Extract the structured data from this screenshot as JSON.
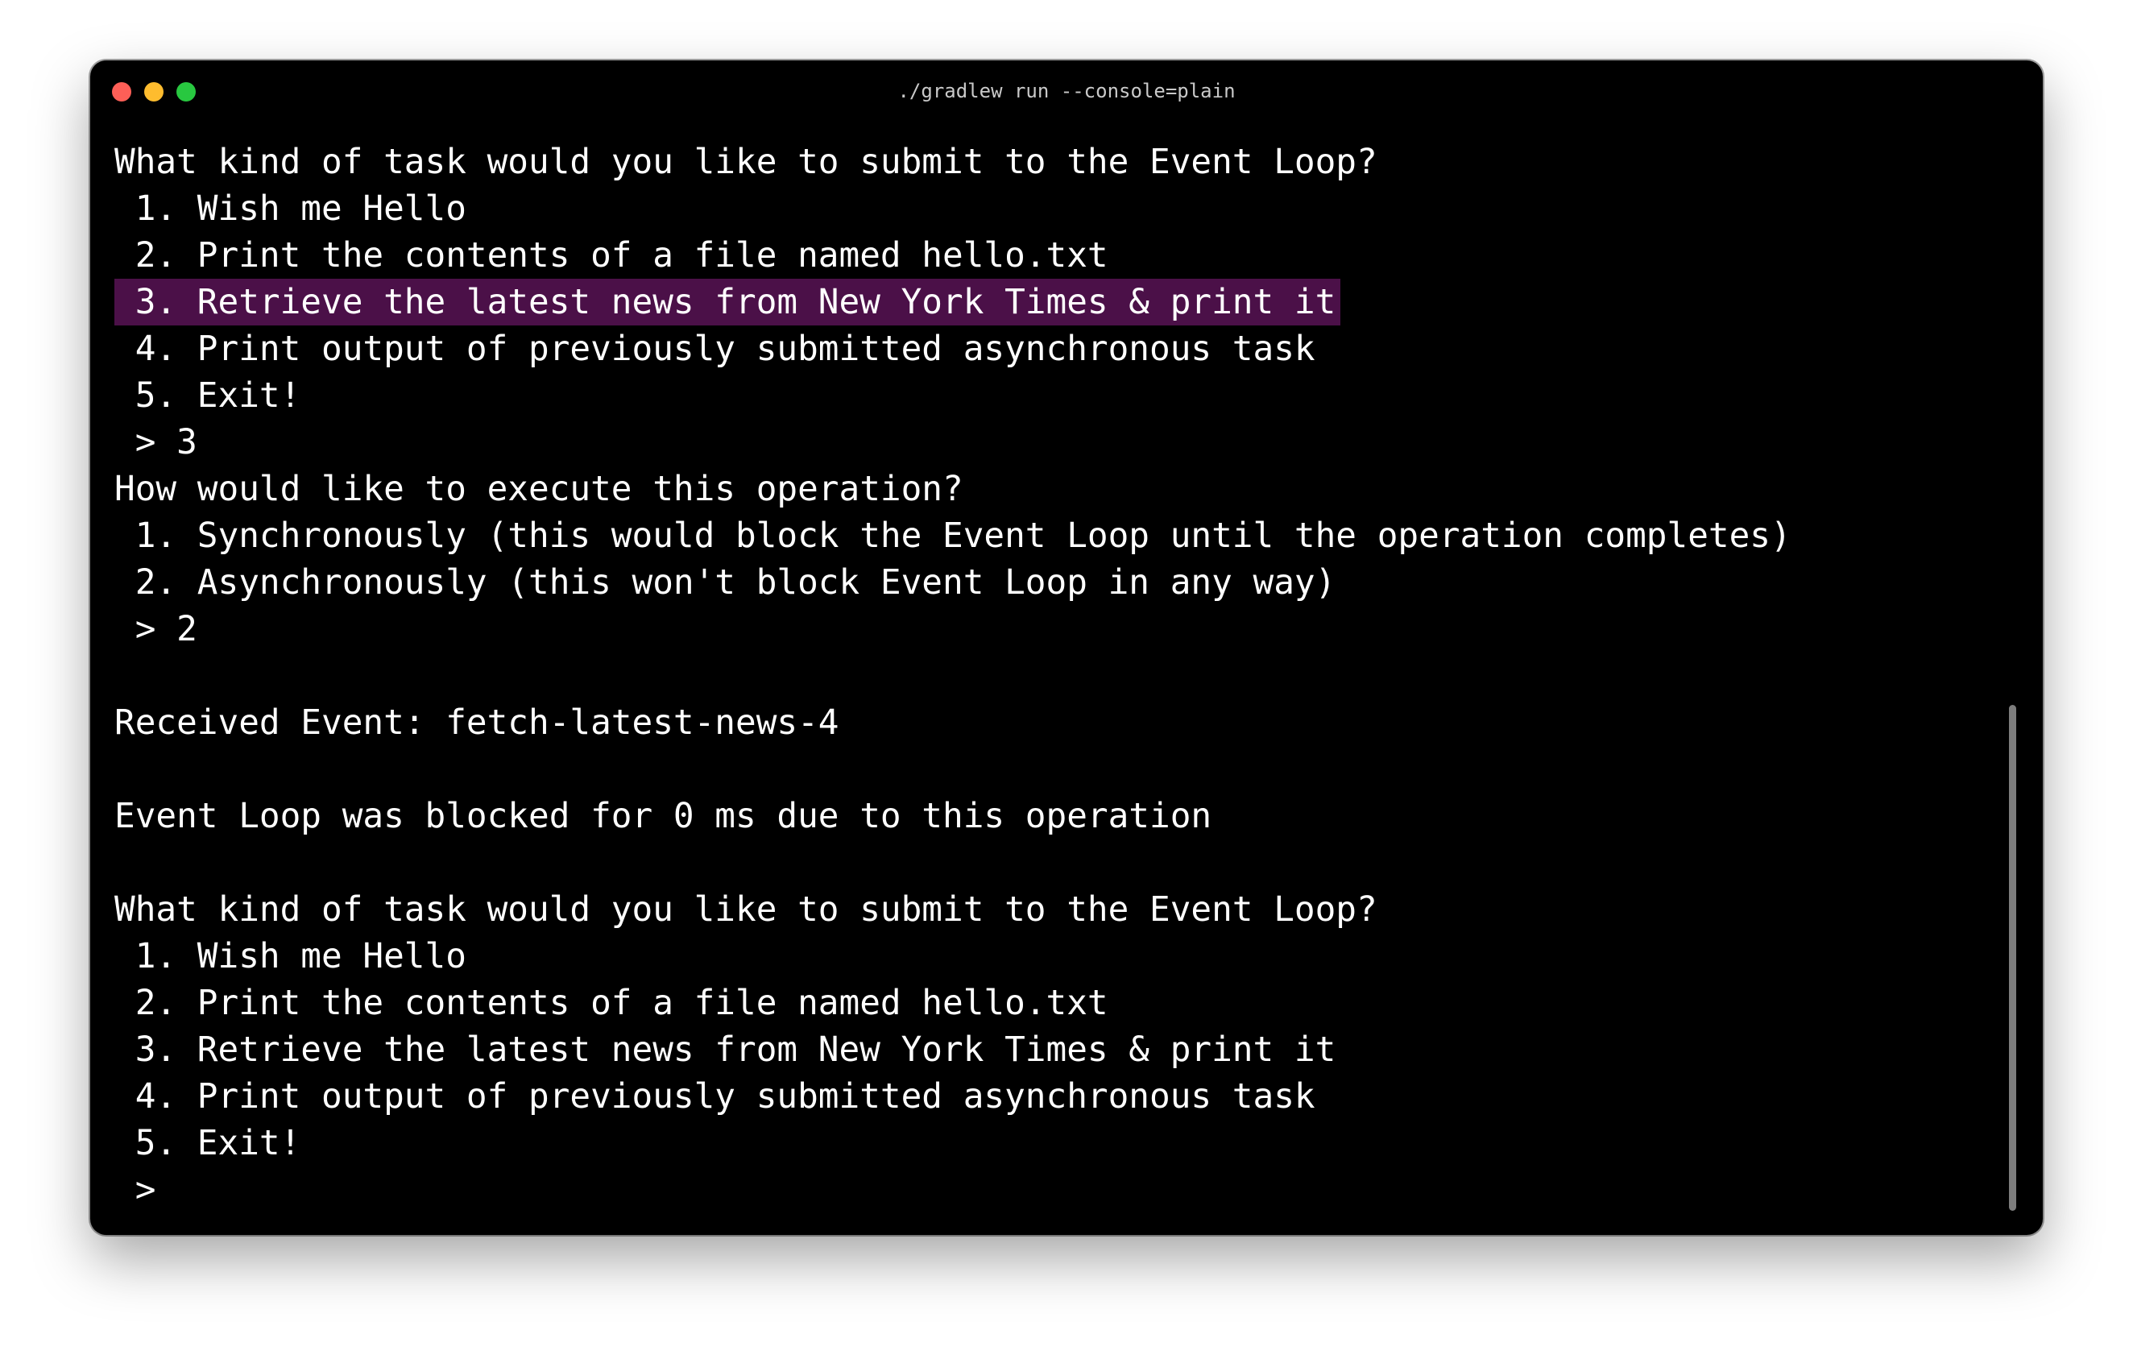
{
  "window": {
    "title": "./gradlew run --console=plain"
  },
  "terminal": {
    "lines": [
      "What kind of task would you like to submit to the Event Loop?",
      " 1. Wish me Hello",
      " 2. Print the contents of a file named hello.txt",
      " 3. Retrieve the latest news from New York Times & print it",
      " 4. Print output of previously submitted asynchronous task",
      " 5. Exit!",
      " > 3",
      "How would like to execute this operation?",
      " 1. Synchronously (this would block the Event Loop until the operation completes)",
      " 2. Asynchronously (this won't block Event Loop in any way)",
      " > 2",
      "",
      "Received Event: fetch-latest-news-4",
      "",
      "Event Loop was blocked for 0 ms due to this operation",
      "",
      "What kind of task would you like to submit to the Event Loop?",
      " 1. Wish me Hello",
      " 2. Print the contents of a file named hello.txt",
      " 3. Retrieve the latest news from New York Times & print it",
      " 4. Print output of previously submitted asynchronous task",
      " 5. Exit!",
      " >"
    ]
  },
  "colors": {
    "background": "#000000",
    "text": "#ffffff",
    "selection": "#4b1048",
    "close": "#fe5f57",
    "minimize": "#febc2e",
    "zoom": "#28c840"
  }
}
